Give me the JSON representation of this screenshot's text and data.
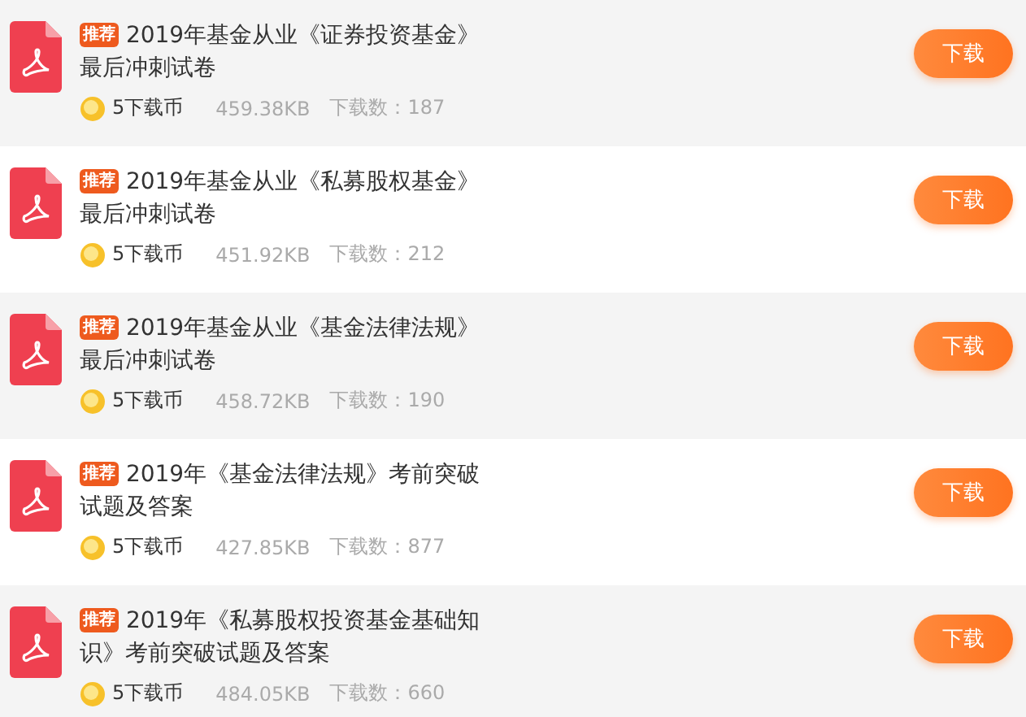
{
  "files": [
    {
      "badge": "推荐",
      "title_lines": [
        "2019年基金从业《证券投资基金》",
        "最后冲刺试卷"
      ],
      "cost": "5下载币",
      "size": "459.38KB",
      "downloads": "下载数：187",
      "button": "下载"
    },
    {
      "badge": "推荐",
      "title_lines": [
        "2019年基金从业《私募股权基金》",
        "最后冲刺试卷"
      ],
      "cost": "5下载币",
      "size": "451.92KB",
      "downloads": "下载数：212",
      "button": "下载"
    },
    {
      "badge": "推荐",
      "title_lines": [
        "2019年基金从业《基金法律法规》",
        "最后冲刺试卷"
      ],
      "cost": "5下载币",
      "size": "458.72KB",
      "downloads": "下载数：190",
      "button": "下载"
    },
    {
      "badge": "推荐",
      "title_lines": [
        "2019年《基金法律法规》考前突破",
        "试题及答案"
      ],
      "cost": "5下载币",
      "size": "427.85KB",
      "downloads": "下载数：877",
      "button": "下载"
    },
    {
      "badge": "推荐",
      "title_lines": [
        "2019年《私募股权投资基金基础知",
        "识》考前突破试题及答案"
      ],
      "cost": "5下载币",
      "size": "484.05KB",
      "downloads": "下载数：660",
      "button": "下载"
    }
  ]
}
